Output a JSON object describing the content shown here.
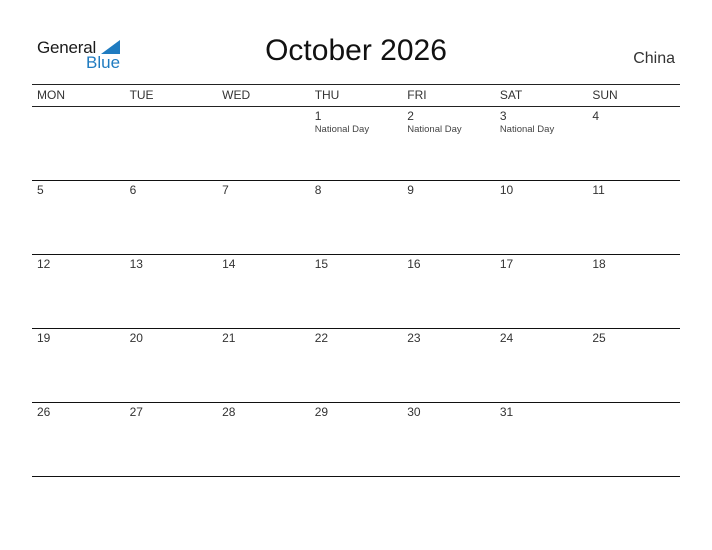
{
  "logo": {
    "text_general": "General",
    "text_blue": "Blue",
    "accent_color": "#1f7bc0"
  },
  "title": "October 2026",
  "country": "China",
  "weekdays": [
    "MON",
    "TUE",
    "WED",
    "THU",
    "FRI",
    "SAT",
    "SUN"
  ],
  "weeks": [
    [
      {
        "day": "",
        "holiday": ""
      },
      {
        "day": "",
        "holiday": ""
      },
      {
        "day": "",
        "holiday": ""
      },
      {
        "day": "1",
        "holiday": "National Day"
      },
      {
        "day": "2",
        "holiday": "National Day"
      },
      {
        "day": "3",
        "holiday": "National Day"
      },
      {
        "day": "4",
        "holiday": ""
      }
    ],
    [
      {
        "day": "5",
        "holiday": ""
      },
      {
        "day": "6",
        "holiday": ""
      },
      {
        "day": "7",
        "holiday": ""
      },
      {
        "day": "8",
        "holiday": ""
      },
      {
        "day": "9",
        "holiday": ""
      },
      {
        "day": "10",
        "holiday": ""
      },
      {
        "day": "11",
        "holiday": ""
      }
    ],
    [
      {
        "day": "12",
        "holiday": ""
      },
      {
        "day": "13",
        "holiday": ""
      },
      {
        "day": "14",
        "holiday": ""
      },
      {
        "day": "15",
        "holiday": ""
      },
      {
        "day": "16",
        "holiday": ""
      },
      {
        "day": "17",
        "holiday": ""
      },
      {
        "day": "18",
        "holiday": ""
      }
    ],
    [
      {
        "day": "19",
        "holiday": ""
      },
      {
        "day": "20",
        "holiday": ""
      },
      {
        "day": "21",
        "holiday": ""
      },
      {
        "day": "22",
        "holiday": ""
      },
      {
        "day": "23",
        "holiday": ""
      },
      {
        "day": "24",
        "holiday": ""
      },
      {
        "day": "25",
        "holiday": ""
      }
    ],
    [
      {
        "day": "26",
        "holiday": ""
      },
      {
        "day": "27",
        "holiday": ""
      },
      {
        "day": "28",
        "holiday": ""
      },
      {
        "day": "29",
        "holiday": ""
      },
      {
        "day": "30",
        "holiday": ""
      },
      {
        "day": "31",
        "holiday": ""
      },
      {
        "day": "",
        "holiday": ""
      }
    ]
  ]
}
